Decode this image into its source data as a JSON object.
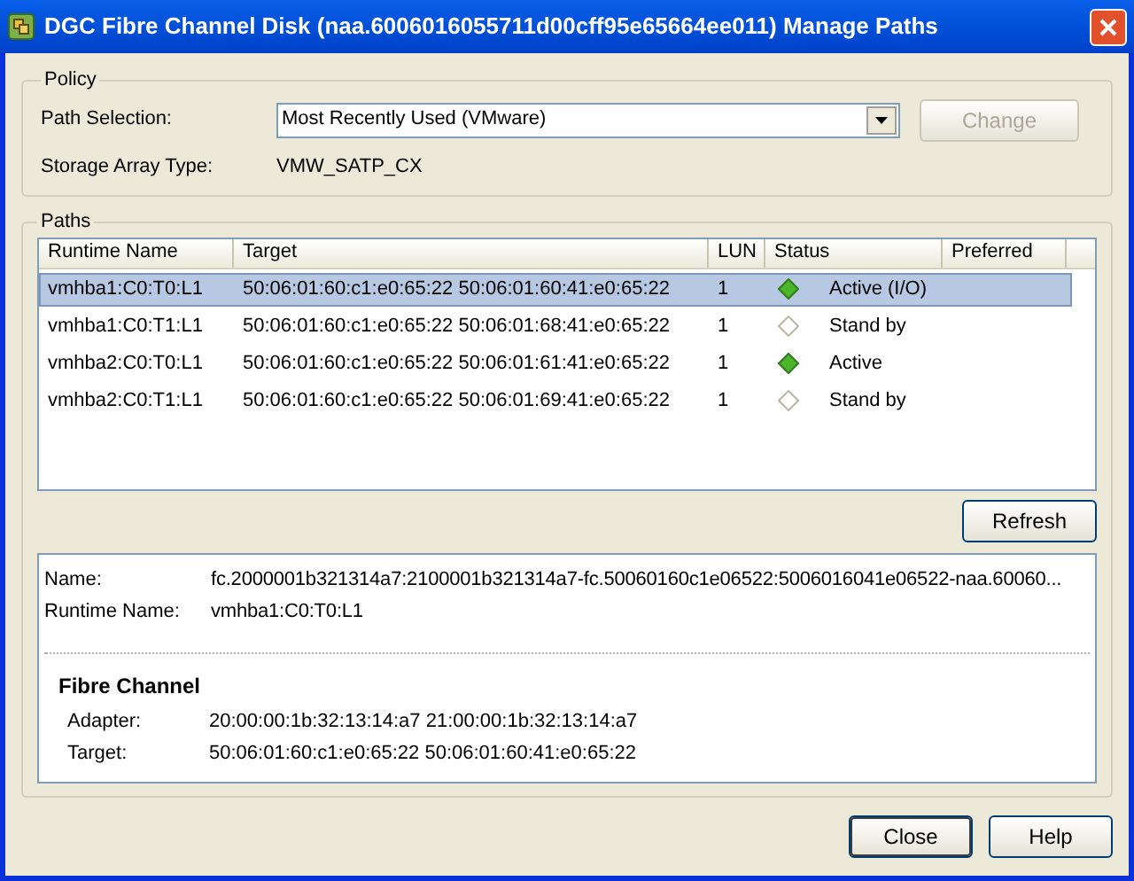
{
  "window": {
    "title": "DGC Fibre Channel Disk (naa.6006016055711d00cff95e65664ee011) Manage Paths"
  },
  "policy": {
    "title": "Policy",
    "path_selection_label": "Path Selection:",
    "path_selection_value": "Most Recently Used (VMware)",
    "change_button": {
      "label": "Change",
      "disabled": true
    },
    "storage_array_label": "Storage Array Type:",
    "storage_array_value": "VMW_SATP_CX"
  },
  "paths": {
    "title": "Paths",
    "columns": [
      "Runtime Name",
      "Target",
      "LUN",
      "Status",
      "Preferred"
    ],
    "rows": [
      {
        "runtime_name": "vmhba1:C0:T0:L1",
        "target": "50:06:01:60:c1:e0:65:22 50:06:01:60:41:e0:65:22",
        "lun": "1",
        "active": true,
        "status": "Active (I/O)",
        "selected": true
      },
      {
        "runtime_name": "vmhba1:C0:T1:L1",
        "target": "50:06:01:60:c1:e0:65:22 50:06:01:68:41:e0:65:22",
        "lun": "1",
        "active": false,
        "status": "Stand by",
        "selected": false
      },
      {
        "runtime_name": "vmhba2:C0:T0:L1",
        "target": "50:06:01:60:c1:e0:65:22 50:06:01:61:41:e0:65:22",
        "lun": "1",
        "active": true,
        "status": "Active",
        "selected": false
      },
      {
        "runtime_name": "vmhba2:C0:T1:L1",
        "target": "50:06:01:60:c1:e0:65:22 50:06:01:69:41:e0:65:22",
        "lun": "1",
        "active": false,
        "status": "Stand by",
        "selected": false
      }
    ],
    "refresh_button": "Refresh"
  },
  "details": {
    "fields": [
      {
        "label": "Name:",
        "value": "fc.2000001b321314a7:2100001b321314a7-fc.50060160c1e06522:5006016041e06522-naa.60060..."
      },
      {
        "label": "Runtime Name:",
        "value": "vmhba1:C0:T0:L1"
      }
    ],
    "section_title": "Fibre Channel",
    "section_fields": [
      {
        "label": "Adapter:",
        "value": "20:00:00:1b:32:13:14:a7 21:00:00:1b:32:13:14:a7"
      },
      {
        "label": "Target:",
        "value": "50:06:01:60:c1:e0:65:22 50:06:01:60:41:e0:65:22"
      }
    ]
  },
  "buttons": [
    "Close",
    "Help"
  ]
}
